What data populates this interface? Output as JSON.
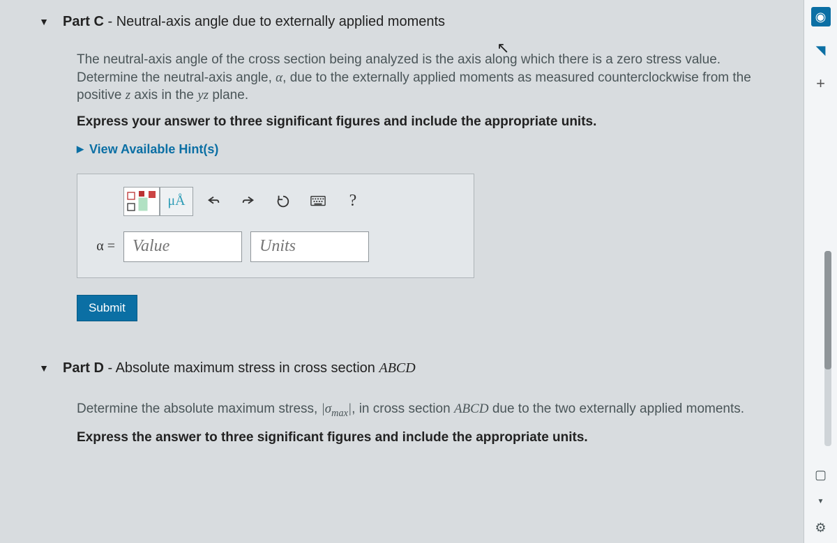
{
  "partC": {
    "collapseGlyph": "▼",
    "titleBold": "Part C",
    "titleSep": " - ",
    "titleSub": "Neutral-axis angle due to externally applied moments",
    "desc_pre": "The neutral-axis angle of the cross section being analyzed is the axis along which there is a zero stress value. Determine the neutral-axis angle, ",
    "alpha": "α",
    "desc_post": ", due to the externally applied moments as measured counterclockwise from the positive ",
    "z": "z",
    "desc_post2": " axis in the ",
    "yz": "yz",
    "desc_post3": " plane.",
    "instruction": "Express your answer to three significant figures and include the appropriate units.",
    "hintsGlyph": "▶",
    "hintsLabel": "View Available Hint(s)",
    "unitsBtn": "μÅ",
    "helpBtn": "?",
    "alphaEq": "α =",
    "valuePH": "Value",
    "unitsPH": "Units",
    "submit": "Submit"
  },
  "partD": {
    "collapseGlyph": "▼",
    "titleBold": "Part D",
    "titleSep": " - ",
    "titleSub_pre": "Absolute maximum stress in cross section ",
    "abcd": "ABCD",
    "desc_pre": "Determine the absolute maximum stress, ",
    "sigma": "|σ",
    "max": "max",
    "sigma_close": "|",
    "desc_mid": ", in cross section ",
    "desc_post": " due to the two externally applied moments.",
    "instruction": "Express the answer to three significant figures and include the appropriate units."
  },
  "sidebar": {
    "camera": "◉",
    "flag": "◥",
    "plus": "+",
    "square": "▢",
    "tri": "▼",
    "gear": "⚙"
  }
}
